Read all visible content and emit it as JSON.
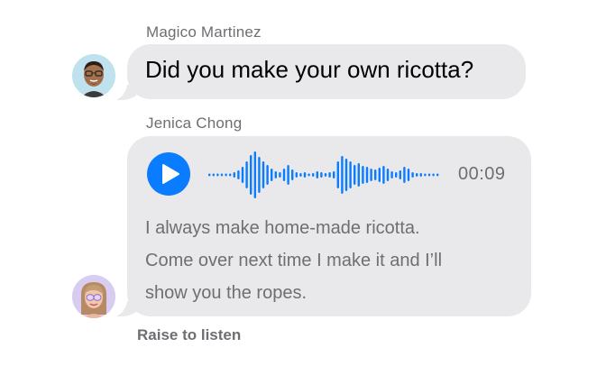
{
  "conversation": {
    "message1": {
      "sender": "Magico Martinez",
      "text": "Did you make your own ricotta?"
    },
    "message2": {
      "sender": "Jenica Chong",
      "audio": {
        "duration": "00:09",
        "play_icon": "play-icon"
      },
      "transcript_lines": [
        "I always make home-made ricotta.",
        "Come over next time I make it and I’ll",
        "show you the ropes."
      ]
    },
    "footer_note": "Raise to listen"
  },
  "colors": {
    "bubble": "#e9e9eb",
    "accent": "#0a7cff",
    "secondary_text": "#6e6e73"
  }
}
